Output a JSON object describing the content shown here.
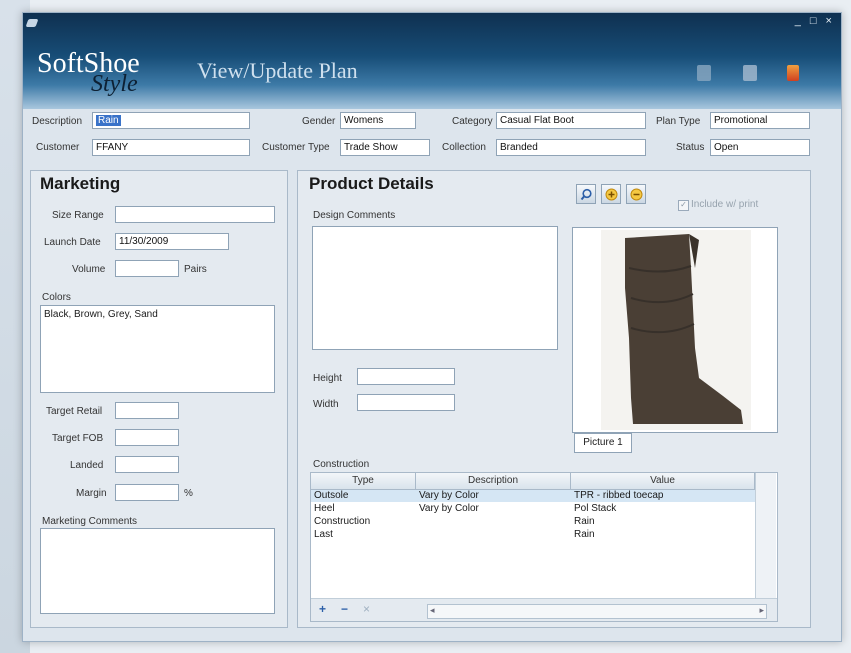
{
  "header": {
    "logo_soft": "SoftShoe",
    "logo_style": "Style",
    "title": "View/Update Plan",
    "window_controls": "_ □ ×"
  },
  "toolbar_icons": [
    "print-icon",
    "save-icon",
    "exit-icon"
  ],
  "fields": {
    "description": {
      "label": "Description",
      "value": "Rain"
    },
    "customer": {
      "label": "Customer",
      "value": "FFANY"
    },
    "gender": {
      "label": "Gender",
      "value": "Womens"
    },
    "customer_type": {
      "label": "Customer Type",
      "value": "Trade Show"
    },
    "category": {
      "label": "Category",
      "value": "Casual Flat Boot"
    },
    "collection": {
      "label": "Collection",
      "value": "Branded"
    },
    "plan_type": {
      "label": "Plan Type",
      "value": "Promotional"
    },
    "status": {
      "label": "Status",
      "value": "Open"
    }
  },
  "marketing": {
    "title": "Marketing",
    "size_range": {
      "label": "Size Range",
      "value": ""
    },
    "launch_date": {
      "label": "Launch Date",
      "value": "11/30/2009"
    },
    "volume": {
      "label": "Volume",
      "value": "",
      "unit": "Pairs"
    },
    "colors": {
      "label": "Colors",
      "value": "Black, Brown, Grey, Sand"
    },
    "target_retail": {
      "label": "Target Retail",
      "value": ""
    },
    "target_fob": {
      "label": "Target FOB",
      "value": ""
    },
    "landed": {
      "label": "Landed",
      "value": ""
    },
    "margin": {
      "label": "Margin",
      "value": "",
      "unit": "%"
    },
    "comments": {
      "label": "Marketing Comments",
      "value": ""
    }
  },
  "product": {
    "title": "Product Details",
    "design_comments": {
      "label": "Design Comments",
      "value": ""
    },
    "height": {
      "label": "Height",
      "value": ""
    },
    "width": {
      "label": "Width",
      "value": ""
    },
    "include_print": "Include w/ print",
    "picture_label": "Picture 1",
    "construction_label": "Construction",
    "columns": [
      "Type",
      "Description",
      "Value"
    ],
    "rows": [
      {
        "type": "Outsole",
        "description": "Vary by Color",
        "value": "TPR - ribbed toecap"
      },
      {
        "type": "Heel",
        "description": "Vary by Color",
        "value": "Pol Stack"
      },
      {
        "type": "Construction",
        "description": "",
        "value": "Rain"
      },
      {
        "type": "Last",
        "description": "",
        "value": "Rain"
      }
    ],
    "grid_buttons": {
      "add": "+",
      "remove": "−",
      "clear": "×"
    }
  },
  "colors": {
    "title_dark": "#0f3050",
    "title_light": "#a9c7de",
    "selected_row": "#d5e6f4",
    "selection": "#3a73c9"
  }
}
